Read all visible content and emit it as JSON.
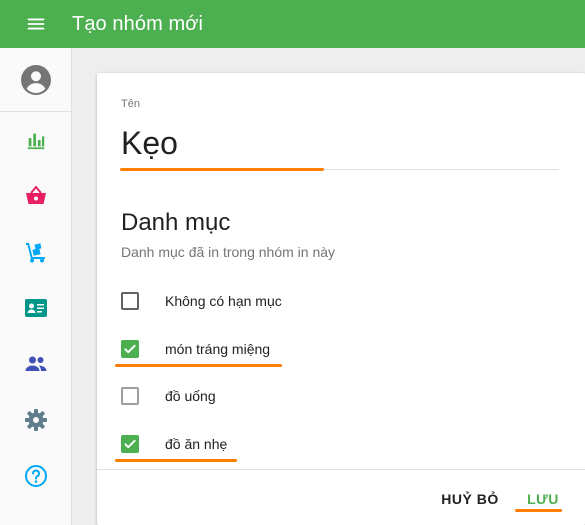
{
  "appbar": {
    "title": "Tạo nhóm mới"
  },
  "sidebar": {
    "items": [
      {
        "icon": "chart-icon",
        "color": "#4caf50"
      },
      {
        "icon": "basket-icon",
        "color": "#e91e63"
      },
      {
        "icon": "hand-truck-icon",
        "color": "#03a9f4"
      },
      {
        "icon": "contact-card-icon",
        "color": "#009688"
      },
      {
        "icon": "group-icon",
        "color": "#3f51b5"
      },
      {
        "icon": "gear-icon",
        "color": "#607d8b"
      },
      {
        "icon": "help-icon",
        "color": "#03a9f4"
      }
    ]
  },
  "form": {
    "name_label": "Tên",
    "name_value": "Kẹo",
    "section_title": "Danh mục",
    "section_subtitle": "Danh mục đã in trong nhóm in này",
    "categories": [
      {
        "label": "Không có hạn mục",
        "checked": false
      },
      {
        "label": "món tráng miệng",
        "checked": true
      },
      {
        "label": "đồ uống",
        "checked": false
      },
      {
        "label": "đồ ăn nhẹ",
        "checked": true
      }
    ]
  },
  "actions": {
    "cancel_label": "HUỶ BỎ",
    "save_label": "LƯU"
  },
  "colors": {
    "primary": "#4caf50",
    "accent": "#ff7f00"
  }
}
